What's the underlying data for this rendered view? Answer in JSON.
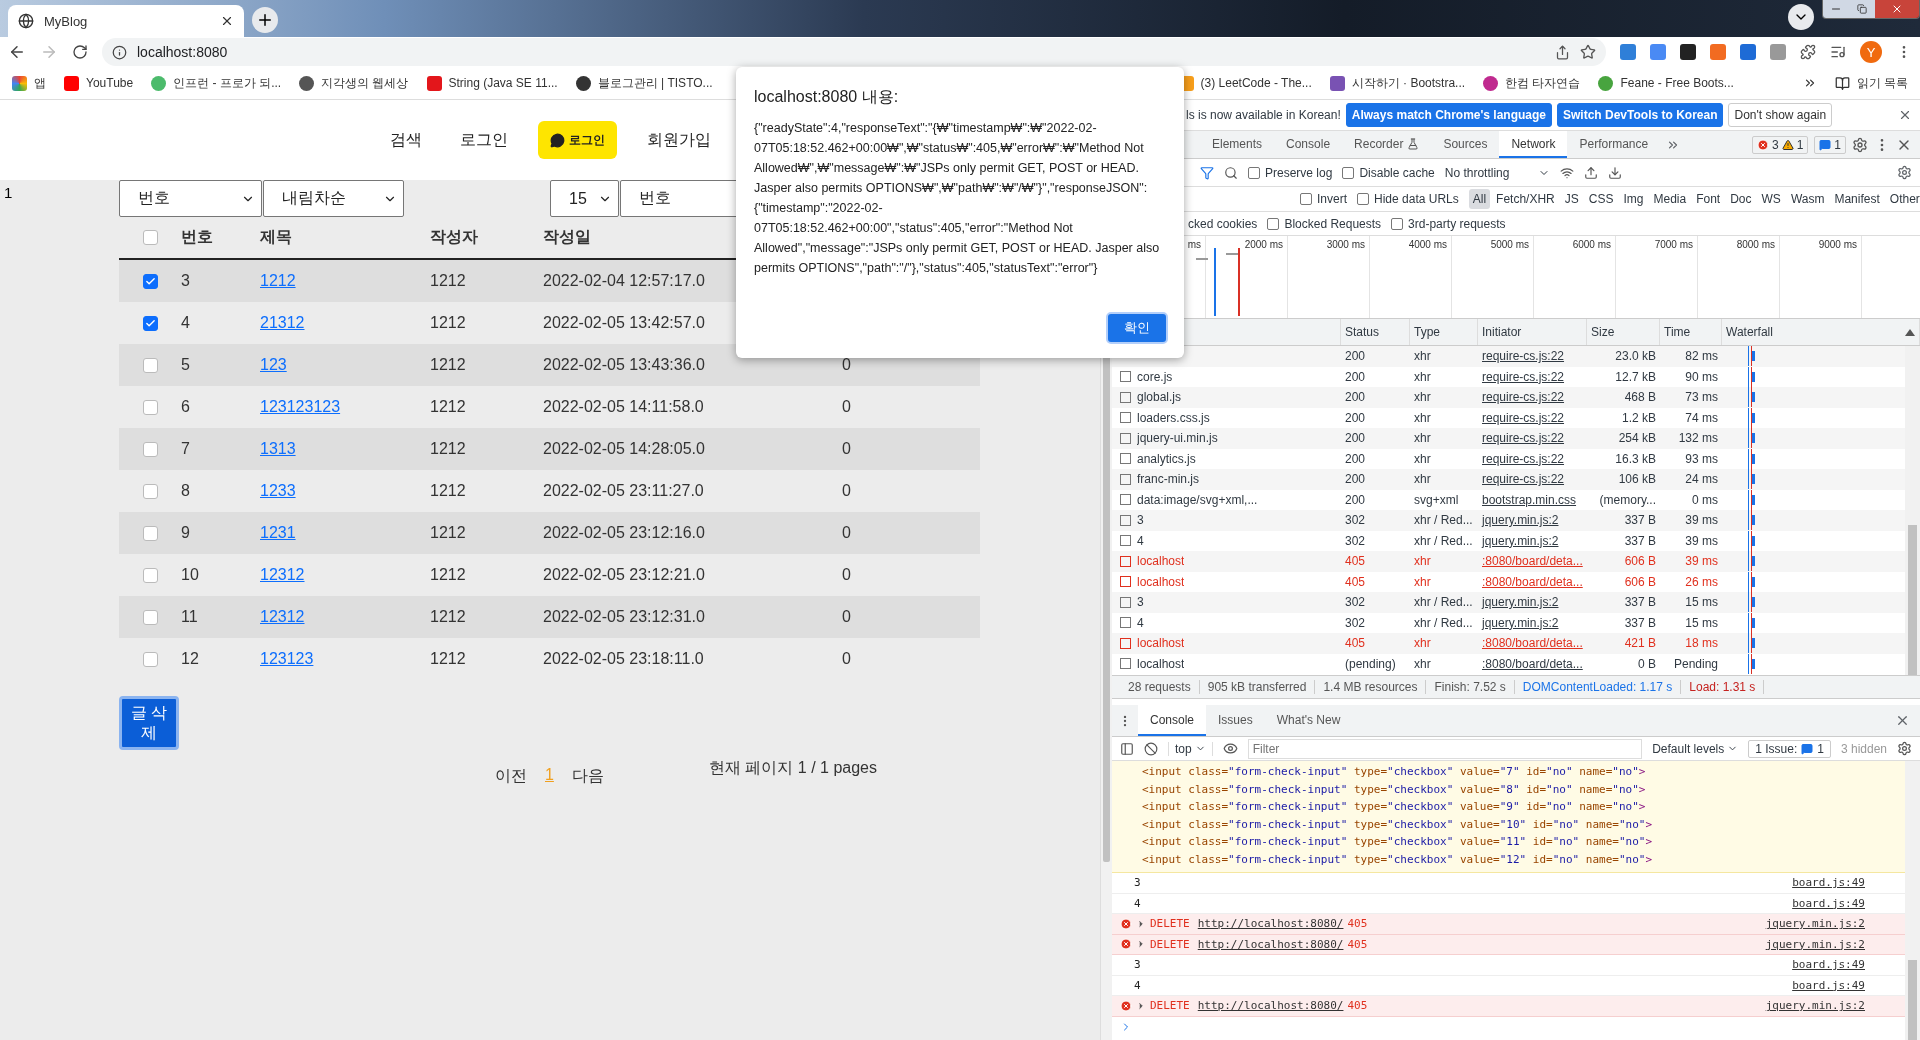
{
  "browser": {
    "tab": {
      "title": "MyBlog"
    },
    "address": "localhost:8080",
    "avatar": "Y",
    "bookmarks": [
      {
        "label": "앱"
      },
      {
        "label": "YouTube"
      },
      {
        "label": "인프런 - 프로가 되..."
      },
      {
        "label": "지각생의 웹세상"
      },
      {
        "label": "String (Java SE 11..."
      },
      {
        "label": "블로그관리 | TISTO..."
      }
    ],
    "bookmarks_right": [
      {
        "label": "(3) LeetCode - The..."
      },
      {
        "label": "시작하기 · Bootstra..."
      },
      {
        "label": "한컴 타자연습"
      },
      {
        "label": "Feane - Free Boots..."
      }
    ],
    "reading_list": "읽기 목록"
  },
  "page": {
    "nav": [
      {
        "label": "검색",
        "kind": "link"
      },
      {
        "label": "로그인",
        "kind": "link"
      },
      {
        "label": "로그인",
        "kind": "kakao"
      },
      {
        "label": "회원가입",
        "kind": "link"
      }
    ],
    "counter": "1",
    "filters": [
      {
        "kind": "select",
        "value": "번호"
      },
      {
        "kind": "select",
        "value": "내림차순"
      },
      {
        "kind": "select",
        "value": "15"
      },
      {
        "kind": "input",
        "value": "번호"
      }
    ],
    "table": {
      "select_all": {
        "checked": false
      },
      "columns": [
        "번호",
        "제목",
        "작성자",
        "작성일"
      ],
      "rows": [
        {
          "checked": true,
          "no": "3",
          "title": "1212",
          "author": "1212",
          "date": "2022-02-04 12:57:17.0"
        },
        {
          "checked": true,
          "no": "4",
          "title": "21312",
          "author": "1212",
          "date": "2022-02-05 13:42:57.0"
        },
        {
          "checked": false,
          "no": "5",
          "title": "123",
          "author": "1212",
          "date": "2022-02-05 13:43:36.0",
          "views": "0"
        },
        {
          "checked": false,
          "no": "6",
          "title": "123123123",
          "author": "1212",
          "date": "2022-02-05 14:11:58.0",
          "views": "0"
        },
        {
          "checked": false,
          "no": "7",
          "title": "1313",
          "author": "1212",
          "date": "2022-02-05 14:28:05.0",
          "views": "0"
        },
        {
          "checked": false,
          "no": "8",
          "title": "1233",
          "author": "1212",
          "date": "2022-02-05 23:11:27.0",
          "views": "0"
        },
        {
          "checked": false,
          "no": "9",
          "title": "1231",
          "author": "1212",
          "date": "2022-02-05 23:12:16.0",
          "views": "0"
        },
        {
          "checked": false,
          "no": "10",
          "title": "12312",
          "author": "1212",
          "date": "2022-02-05 23:12:21.0",
          "views": "0"
        },
        {
          "checked": false,
          "no": "11",
          "title": "12312",
          "author": "1212",
          "date": "2022-02-05 23:12:31.0",
          "views": "0"
        },
        {
          "checked": false,
          "no": "12",
          "title": "123123",
          "author": "1212",
          "date": "2022-02-05 23:18:11.0",
          "views": "0"
        }
      ]
    },
    "delete_button": "글 삭제",
    "pagination": {
      "prev": "이전",
      "pages": [
        {
          "label": "1",
          "selected": true
        }
      ],
      "next": "다음"
    },
    "page_info": "현재 페이지 1 / 1 pages"
  },
  "dialog": {
    "title": "localhost:8080 내용:",
    "message": "{\"readyState\":4,\"responseText\":\"{₩\"timestamp₩\":₩\"2022-02-07T05:18:52.462+00:00₩\",₩\"status₩\":405,₩\"error₩\":₩\"Method Not Allowed₩\",₩\"message₩\":₩\"JSPs only permit GET, POST or HEAD. Jasper also permits OPTIONS₩\",₩\"path₩\":₩\"/₩\"}\",\"responseJSON\":{\"timestamp\":\"2022-02-07T05:18:52.462+00:00\",\"status\":405,\"error\":\"Method Not Allowed\",\"message\":\"JSPs only permit GET, POST or HEAD. Jasper also permits OPTIONS\",\"path\":\"/\"},\"status\":405,\"statusText\":\"error\"}",
    "ok": "확인"
  },
  "devtools": {
    "infobar": {
      "text": "ls is now available in Korean!",
      "buttons": [
        {
          "label": "Always match Chrome's language",
          "kind": "primary"
        },
        {
          "label": "Switch DevTools to Korean",
          "kind": "primary"
        },
        {
          "label": "Don't show again",
          "kind": "plain"
        }
      ]
    },
    "tabs": [
      {
        "label": "Elements",
        "selected": false
      },
      {
        "label": "Console",
        "selected": false
      },
      {
        "label": "Recorder",
        "selected": false
      },
      {
        "label": "Sources",
        "selected": false
      },
      {
        "label": "Network",
        "selected": true
      },
      {
        "label": "Performance",
        "selected": false
      }
    ],
    "errors": "3",
    "warnings": "1",
    "messages": "1",
    "toolbar": {
      "checkboxes": [
        {
          "label": "Preserve log",
          "checked": false
        },
        {
          "label": "Disable cache",
          "checked": false
        }
      ],
      "throttling": "No throttling"
    },
    "filter_checkboxes": [
      {
        "label": "Invert",
        "checked": false
      },
      {
        "label": "Hide data URLs",
        "checked": false
      }
    ],
    "types": [
      {
        "label": "All",
        "selected": true
      },
      {
        "label": "Fetch/XHR",
        "selected": false
      },
      {
        "label": "JS",
        "selected": false
      },
      {
        "label": "CSS",
        "selected": false
      },
      {
        "label": "Img",
        "selected": false
      },
      {
        "label": "Media",
        "selected": false
      },
      {
        "label": "Font",
        "selected": false
      },
      {
        "label": "Doc",
        "selected": false
      },
      {
        "label": "WS",
        "selected": false
      },
      {
        "label": "Wasm",
        "selected": false
      },
      {
        "label": "Manifest",
        "selected": false
      },
      {
        "label": "Other",
        "selected": false
      }
    ],
    "blocked": [
      {
        "label": "cked cookies"
      },
      {
        "label": "Blocked Requests",
        "checked": false
      },
      {
        "label": "3rd-party requests",
        "checked": false
      }
    ],
    "overview_ticks": [
      "ms",
      "2000 ms",
      "3000 ms",
      "4000 ms",
      "5000 ms",
      "6000 ms",
      "7000 ms",
      "8000 ms",
      "9000 ms"
    ],
    "columns": [
      "Status",
      "Type",
      "Initiator",
      "Size",
      "Time",
      "Waterfall"
    ],
    "requests": [
      {
        "status": "200",
        "type": "xhr",
        "initiator": "require-cs.js:22",
        "size": "23.0 kB",
        "time": "82 ms",
        "error": false
      },
      {
        "name": "core.js",
        "status": "200",
        "type": "xhr",
        "initiator": "require-cs.js:22",
        "size": "12.7 kB",
        "time": "90 ms",
        "error": false
      },
      {
        "name": "global.js",
        "status": "200",
        "type": "xhr",
        "initiator": "require-cs.js:22",
        "size": "468 B",
        "time": "73 ms",
        "error": false
      },
      {
        "name": "loaders.css.js",
        "status": "200",
        "type": "xhr",
        "initiator": "require-cs.js:22",
        "size": "1.2 kB",
        "time": "74 ms",
        "error": false
      },
      {
        "name": "jquery-ui.min.js",
        "status": "200",
        "type": "xhr",
        "initiator": "require-cs.js:22",
        "size": "254 kB",
        "time": "132 ms",
        "error": false
      },
      {
        "name": "analytics.js",
        "status": "200",
        "type": "xhr",
        "initiator": "require-cs.js:22",
        "size": "16.3 kB",
        "time": "93 ms",
        "error": false
      },
      {
        "name": "franc-min.js",
        "status": "200",
        "type": "xhr",
        "initiator": "require-cs.js:22",
        "size": "106 kB",
        "time": "24 ms",
        "error": false
      },
      {
        "name": "data:image/svg+xml,...",
        "status": "200",
        "type": "svg+xml",
        "initiator": "bootstrap.min.css",
        "size": "(memory...",
        "time": "0 ms",
        "error": false
      },
      {
        "name": "3",
        "status": "302",
        "type": "xhr / Red...",
        "initiator": "jquery.min.js:2",
        "size": "337 B",
        "time": "39 ms",
        "error": false
      },
      {
        "name": "4",
        "status": "302",
        "type": "xhr / Red...",
        "initiator": "jquery.min.js:2",
        "size": "337 B",
        "time": "39 ms",
        "error": false
      },
      {
        "name": "localhost",
        "status": "405",
        "type": "xhr",
        "initiator": ":8080/board/deta...",
        "size": "606 B",
        "time": "39 ms",
        "error": true
      },
      {
        "name": "localhost",
        "status": "405",
        "type": "xhr",
        "initiator": ":8080/board/deta...",
        "size": "606 B",
        "time": "26 ms",
        "error": true
      },
      {
        "name": "3",
        "status": "302",
        "type": "xhr / Red...",
        "initiator": "jquery.min.js:2",
        "size": "337 B",
        "time": "15 ms",
        "error": false
      },
      {
        "name": "4",
        "status": "302",
        "type": "xhr / Red...",
        "initiator": "jquery.min.js:2",
        "size": "337 B",
        "time": "15 ms",
        "error": false
      },
      {
        "name": "localhost",
        "status": "405",
        "type": "xhr",
        "initiator": ":8080/board/deta...",
        "size": "421 B",
        "time": "18 ms",
        "error": true
      },
      {
        "name": "localhost",
        "status": "(pending)",
        "type": "xhr",
        "initiator": ":8080/board/deta...",
        "size": "0 B",
        "time": "Pending",
        "error": false
      }
    ],
    "summary": [
      {
        "text": "28 requests",
        "kind": "plain"
      },
      {
        "text": "905 kB transferred",
        "kind": "plain"
      },
      {
        "text": "1.4 MB resources",
        "kind": "plain"
      },
      {
        "text": "Finish: 7.52 s",
        "kind": "plain"
      },
      {
        "text": "DOMContentLoaded: 1.17 s",
        "kind": "dom"
      },
      {
        "text": "Load: 1.31 s",
        "kind": "load"
      }
    ],
    "drawer_tabs": [
      {
        "label": "Console",
        "selected": true
      },
      {
        "label": "Issues",
        "selected": false
      },
      {
        "label": "What's New",
        "selected": false
      }
    ],
    "console": {
      "context": "top",
      "filter_placeholder": "Filter",
      "levels": "Default levels",
      "issues_label": "1 Issue:",
      "issues_count": "1",
      "hidden": "3 hidden",
      "messages": [
        {
          "kind": "html",
          "lines": [
            "<input class=\"form-check-input\" type=\"checkbox\" value=\"7\" id=\"no\" name=\"no\">",
            "<input class=\"form-check-input\" type=\"checkbox\" value=\"8\" id=\"no\" name=\"no\">",
            "<input class=\"form-check-input\" type=\"checkbox\" value=\"9\" id=\"no\" name=\"no\">",
            "<input class=\"form-check-input\" type=\"checkbox\" value=\"10\" id=\"no\" name=\"no\">",
            "<input class=\"form-check-input\" type=\"checkbox\" value=\"11\" id=\"no\" name=\"no\">",
            "<input class=\"form-check-input\" type=\"checkbox\" value=\"12\" id=\"no\" name=\"no\">"
          ]
        },
        {
          "kind": "log",
          "text": "3",
          "source": "board.js:49"
        },
        {
          "kind": "log",
          "text": "4",
          "source": "board.js:49"
        },
        {
          "kind": "error",
          "method": "DELETE",
          "url": "http://localhost:8080/",
          "status": "405",
          "source": "jquery.min.js:2"
        },
        {
          "kind": "error",
          "method": "DELETE",
          "url": "http://localhost:8080/",
          "status": "405",
          "source": "jquery.min.js:2"
        },
        {
          "kind": "log",
          "text": "3",
          "source": "board.js:49"
        },
        {
          "kind": "log",
          "text": "4",
          "source": "board.js:49"
        },
        {
          "kind": "error",
          "method": "DELETE",
          "url": "http://localhost:8080/",
          "status": "405",
          "source": "jquery.min.js:2"
        }
      ]
    }
  }
}
